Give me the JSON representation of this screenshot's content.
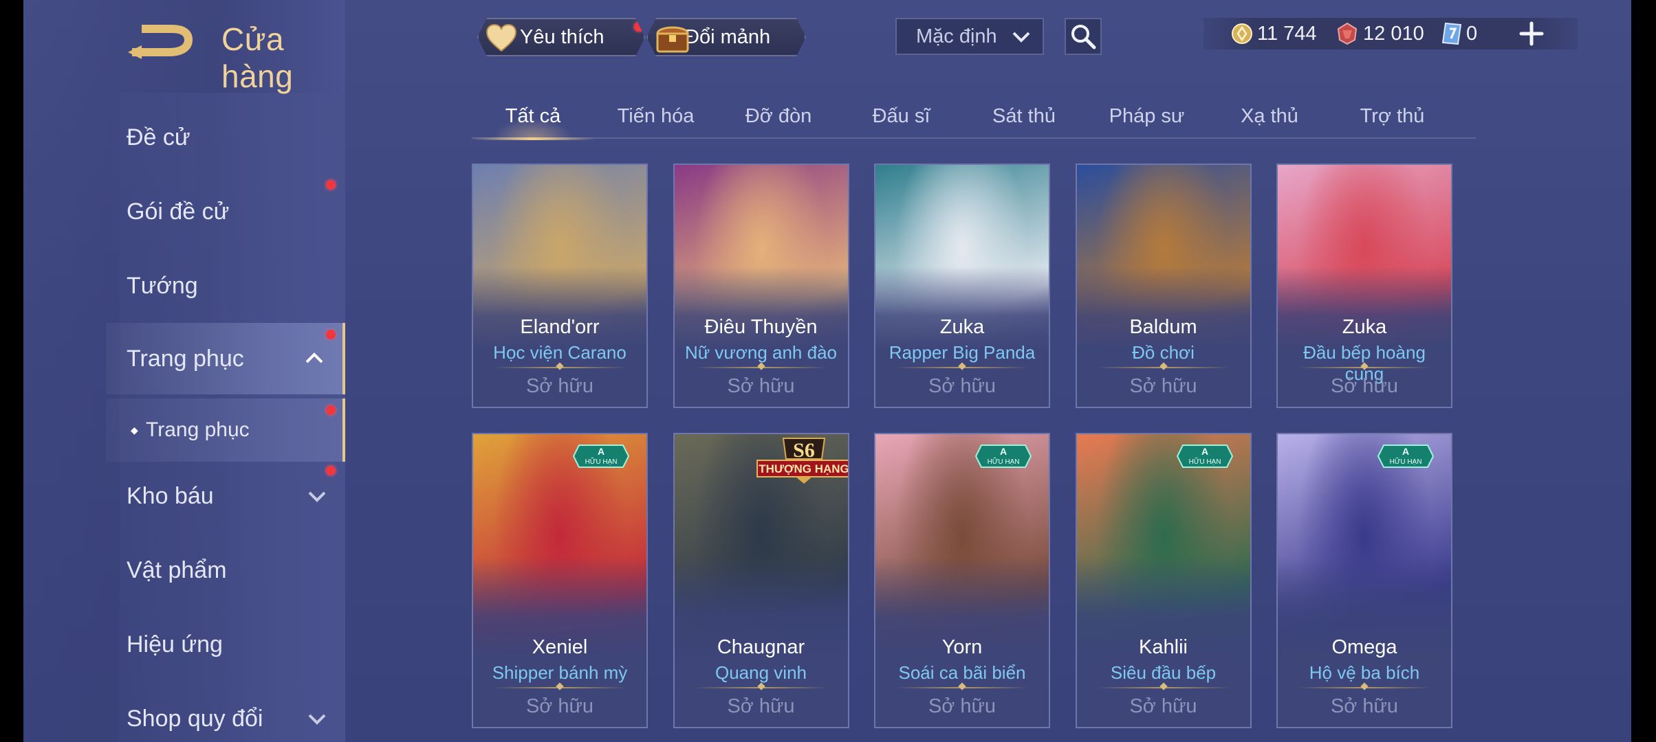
{
  "header": {
    "title": "Cửa hàng",
    "favorite_label": "Yêu thích",
    "exchange_label": "Đổi mảnh",
    "sort_value": "Mặc định"
  },
  "currencies": {
    "gold": "11 744",
    "vouchers": "12 010",
    "tickets": "0"
  },
  "sidebar": {
    "items": [
      {
        "label": "Đề cử"
      },
      {
        "label": "Gói đề cử"
      },
      {
        "label": "Tướng"
      },
      {
        "label": "Trang phục"
      },
      {
        "label": "Trang phục"
      },
      {
        "label": "Kho báu"
      },
      {
        "label": "Vật phẩm"
      },
      {
        "label": "Hiệu ứng"
      },
      {
        "label": "Shop quy đổi"
      }
    ]
  },
  "tabs": [
    {
      "label": "Tất cả"
    },
    {
      "label": "Tiến hóa"
    },
    {
      "label": "Đỡ đòn"
    },
    {
      "label": "Đấu sĩ"
    },
    {
      "label": "Sát thủ"
    },
    {
      "label": "Pháp sư"
    },
    {
      "label": "Xạ thủ"
    },
    {
      "label": "Trợ thủ"
    }
  ],
  "cards": [
    {
      "hero": "Eland'orr",
      "skin": "Học viện Carano",
      "status": "Sở hữu",
      "bg1": "#6d7fb0",
      "bg2": "#c9a66a"
    },
    {
      "hero": "Điêu Thuyền",
      "skin": "Nữ vương anh đào",
      "status": "Sở hữu",
      "bg1": "#8a3a86",
      "bg2": "#e4b07a"
    },
    {
      "hero": "Zuka",
      "skin": "Rapper Big Panda",
      "status": "Sở hữu",
      "bg1": "#2f7e8e",
      "bg2": "#e5e9f0"
    },
    {
      "hero": "Baldum",
      "skin": "Đồ chơi",
      "status": "Sở hữu",
      "bg1": "#2a4d9c",
      "bg2": "#b47a3c"
    },
    {
      "hero": "Zuka",
      "skin": "Đầu bếp hoàng cung",
      "status": "Sở hữu",
      "bg1": "#e6a6c8",
      "bg2": "#d8495a"
    },
    {
      "hero": "Xeniel",
      "skin": "Shipper bánh mỳ",
      "status": "Sở hữu",
      "bg1": "#e0a23a",
      "bg2": "#c22a3a",
      "badge_letter": "A",
      "badge_text": "HỮU HẠN"
    },
    {
      "hero": "Chaugnar",
      "skin": "Quang vinh",
      "status": "Sở hữu",
      "bg1": "#6b6a58",
      "bg2": "#2e3a4a",
      "badge_letter": "S6",
      "badge_text": "THƯỢNG HẠNG"
    },
    {
      "hero": "Yorn",
      "skin": "Soái ca bãi biển",
      "status": "Sở hữu",
      "bg1": "#e8a7b7",
      "bg2": "#7a4b3a",
      "badge_letter": "A",
      "badge_text": "HỮU HẠN"
    },
    {
      "hero": "Kahlii",
      "skin": "Siêu đầu bếp",
      "status": "Sở hữu",
      "bg1": "#e87a52",
      "bg2": "#2f6b4e",
      "badge_letter": "A",
      "badge_text": "HỮU HẠN"
    },
    {
      "hero": "Omega",
      "skin": "Hộ vệ ba bích",
      "status": "Sở hữu",
      "bg1": "#b8b0e8",
      "bg2": "#3a3a8c",
      "badge_letter": "A",
      "badge_text": "HỮU HẠN"
    }
  ],
  "colors": {
    "accent_gold": "#efd39a",
    "skin_name_blue": "#7fc8f2",
    "notification_red": "#f0363e"
  },
  "icons": [
    "back-arrow-icon",
    "heart-icon",
    "chest-icon",
    "chevron-down-icon",
    "search-icon",
    "gold-coin-icon",
    "voucher-gem-icon",
    "ticket-icon",
    "plus-icon",
    "chevron-up-icon"
  ]
}
